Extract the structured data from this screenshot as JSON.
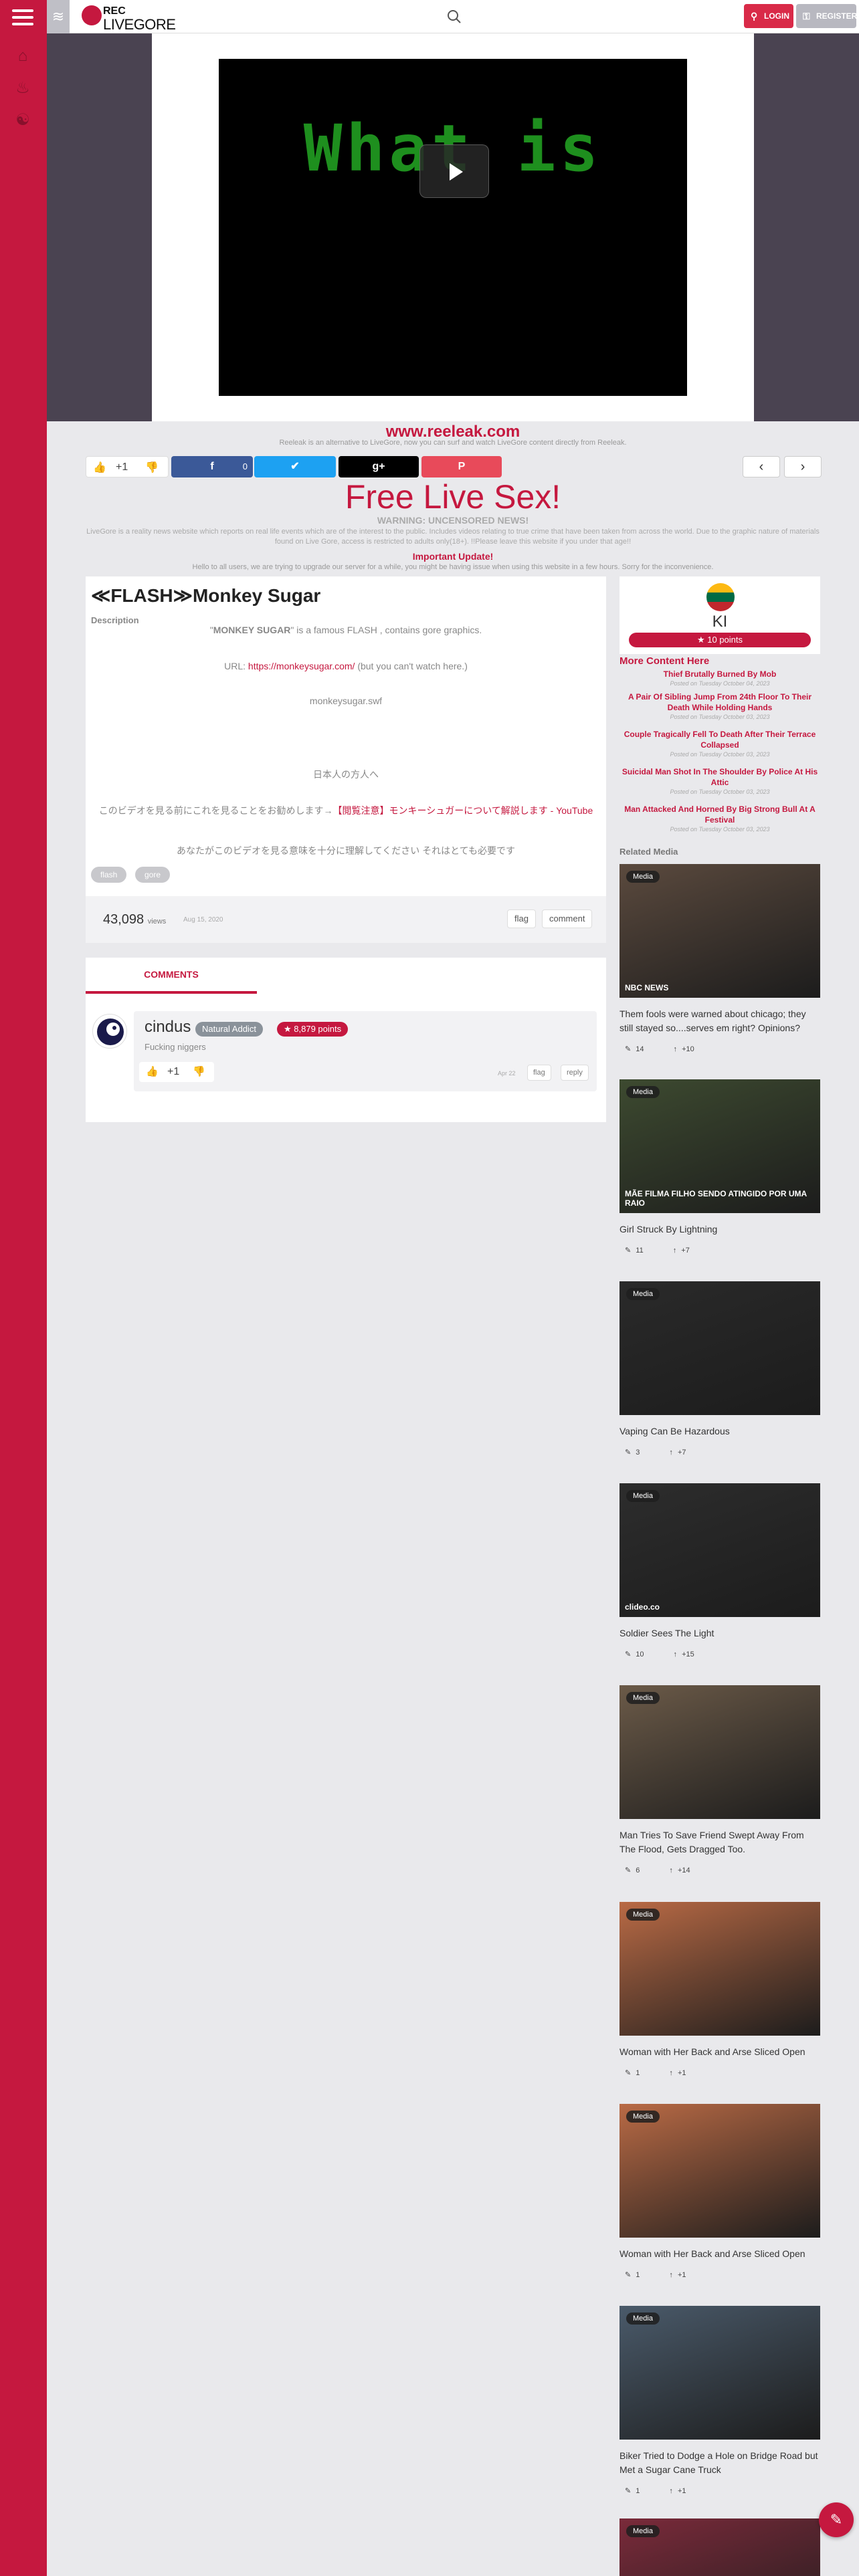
{
  "header": {
    "logo_rec": "REC",
    "logo_name": "LIVEGORE",
    "login": "LOGIN",
    "register": "REGISTER",
    "icons": [
      "menu-icon",
      "home-icon",
      "fire-icon",
      "ufo-icon",
      "search-icon",
      "wave-icon"
    ]
  },
  "player": {
    "screen_text": "What is",
    "play_icon": "play-icon"
  },
  "actions": {
    "site_link": "www.reeleak.com",
    "alt_text": "Reeleak is an alternative to LiveGore, now you can surf and watch LiveGore content directly from Reeleak.",
    "vote_count": "+1",
    "fb_count": "0",
    "fb_icon": "f",
    "tw_icon": "✉",
    "gp_icon": "g+",
    "pi_icon": "P"
  },
  "notice": {
    "promo": "Free Live Sex!",
    "warn": "WARNING: UNCENSORED NEWS!",
    "blurb": "LiveGore is a reality news website which reports on real life events which are of the interest to the public. Includes videos relating to true crime that have been taken from across the world. Due to the graphic nature of materials found on Live Gore, access is restricted to adults only(18+). !!Please leave this website if you under that age!!",
    "important": "Important Update!",
    "hello": "Hello to all users, we are trying to upgrade our server for a while, you might be having issue when using this website in a few hours. Sorry for the inconvenience."
  },
  "post": {
    "title": "≪FLASH≫Monkey Sugar",
    "desc_label": "Description",
    "line1_pre": "\"",
    "line1_bold": "MONKEY SUGAR",
    "line1_post": "\" is a famous FLASH , contains gore graphics.",
    "line2_pre": "URL: ",
    "line2_link": "https://monkeysugar.com/",
    "line2_post": " (but you can't watch here.)",
    "line3": "monkeysugar.swf",
    "line4": "日本人の方人へ",
    "line5_pre": "このビデオを見る前にこれを見ることをお勧めします→",
    "line5_link": "【閲覧注意】モンキーシュガーについて解説します - YouTube",
    "line6": "あなたがこのビデオを見る意味を十分に理解してください それはとても必要です",
    "tags": [
      "flash",
      "gore"
    ],
    "views": "43,098",
    "views_label": "views",
    "date": "Aug 15, 2020",
    "flag": "flag",
    "comment": "comment"
  },
  "comments": {
    "tab": "COMMENTS",
    "items": [
      {
        "user": "cindus",
        "level": "Natural Addict",
        "points": "8,879 points",
        "text": "Fucking niggers",
        "votes": "+1",
        "date": "Apr 22",
        "flag": "flag",
        "reply": "reply"
      }
    ]
  },
  "sidebar": {
    "user": {
      "name": "KI",
      "points": "10 points"
    },
    "more_head": "More Content Here",
    "more": [
      {
        "title": "Thief Brutally Burned By Mob",
        "posted": "Posted on Tuesday October 04, 2023"
      },
      {
        "title": "A Pair Of Sibling Jump From 24th Floor To Their Death While Holding Hands",
        "posted": "Posted on Tuesday October 03, 2023"
      },
      {
        "title": "Couple Tragically Fell To Death After Their Terrace Collapsed",
        "posted": "Posted on Tuesday October 03, 2023"
      },
      {
        "title": "Suicidal Man Shot In The Shoulder By Police At His Attic",
        "posted": "Posted on Tuesday October 03, 2023"
      },
      {
        "title": "Man Attacked And Horned By Big Strong Bull At A Festival",
        "posted": "Posted on Tuesday October 03, 2023"
      }
    ],
    "related_head": "Related Media",
    "media_tag": "Media",
    "related": [
      {
        "title": "Them fools were warned about chicago; they still stayed so....serves em right? Opinions?",
        "comments": "14",
        "likes": "+10",
        "color": "#5b4a3e",
        "overlay": "NBC NEWS"
      },
      {
        "title": "Girl Struck By Lightning",
        "comments": "11",
        "likes": "+7",
        "color": "#3d4a30",
        "overlay": "MÃE FILMA FILHO SENDO ATINGIDO POR UMA RAIO"
      },
      {
        "title": "Vaping Can Be Hazardous",
        "comments": "3",
        "likes": "+7",
        "color": "#2a2a2a",
        "overlay": ""
      },
      {
        "title": "Soldier Sees The Light",
        "comments": "10",
        "likes": "+15",
        "color": "#2d2d2d",
        "overlay": "clideo.co"
      },
      {
        "title": "Man Tries To Save Friend Swept Away From The Flood, Gets Dragged Too.",
        "comments": "6",
        "likes": "+14",
        "color": "#6b5a48",
        "overlay": ""
      },
      {
        "title": "Woman with Her Back and Arse Sliced Open",
        "comments": "1",
        "likes": "+1",
        "color": "#b96a45",
        "overlay": ""
      },
      {
        "title": "Woman with Her Back and Arse Sliced Open",
        "comments": "1",
        "likes": "+1",
        "color": "#b96a45",
        "overlay": ""
      },
      {
        "title": "Biker Tried to Dodge a Hole on Bridge Road but Met a Sugar Cane Truck",
        "comments": "1",
        "likes": "+1",
        "color": "#4a5a6a",
        "overlay": ""
      },
      {
        "title": "",
        "comments": "",
        "likes": "",
        "color": "#7a2a3a",
        "overlay": ""
      }
    ]
  },
  "colors": {
    "accent": "#c5183f",
    "rail": "#c5183f",
    "facebook": "#3b5998",
    "twitter": "#1da1f2",
    "pinterest": "#e84a5a"
  }
}
